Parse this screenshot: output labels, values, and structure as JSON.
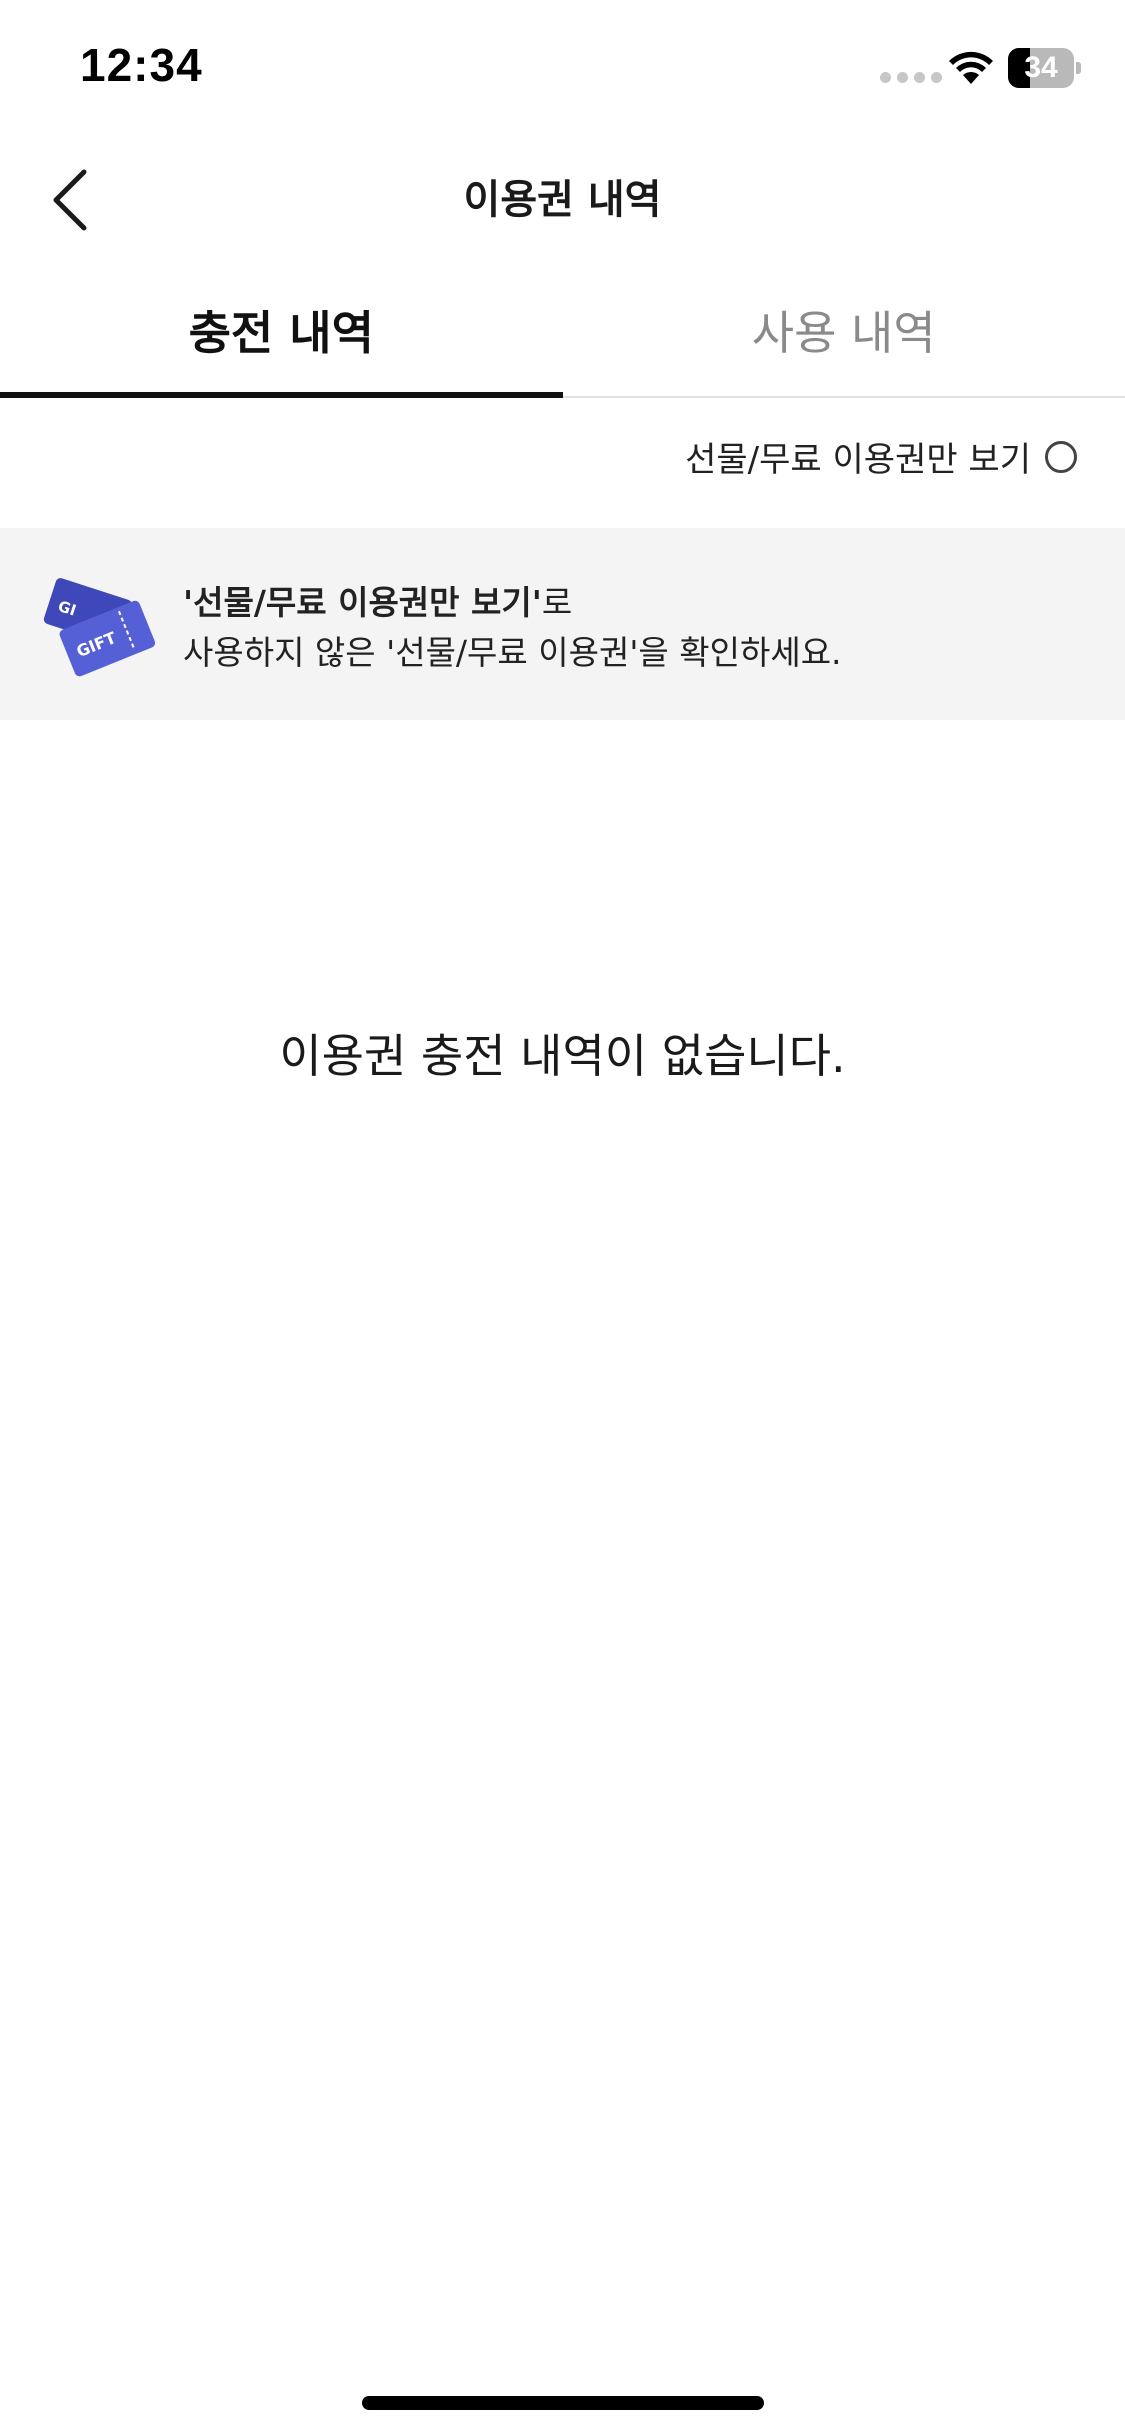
{
  "status_bar": {
    "time": "12:34",
    "battery_level": "34",
    "battery_fraction": 0.34
  },
  "header": {
    "title": "이용권 내역",
    "back_icon": "chevron-left-icon"
  },
  "tabs": [
    {
      "label": "충전 내역",
      "active": true
    },
    {
      "label": "사용 내역",
      "active": false
    }
  ],
  "filter": {
    "label": "선물/무료 이용권만 보기",
    "checked": false
  },
  "banner": {
    "icon": "gift-ticket-icon",
    "icon_text": "GIFT",
    "line1_bold": "'선물/무료 이용권만 보기'",
    "line1_rest": "로",
    "line2": "사용하지 않은 '선물/무료 이용권'을 확인하세요."
  },
  "empty_state": {
    "message": "이용권 충전 내역이 없습니다."
  },
  "colors": {
    "accent": "#111111",
    "inactive_tab": "#8a8a8a",
    "banner_bg": "#f4f4f4",
    "ticket_blue": "#4a55c9"
  }
}
